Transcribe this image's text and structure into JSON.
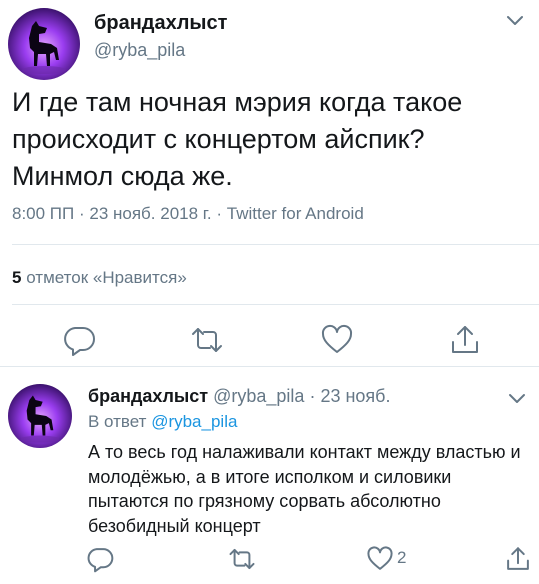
{
  "tweet": {
    "display_name": "брандахлыст",
    "handle": "@ryba_pila",
    "text": "И где там ночная мэрия когда такое происходит с концертом айспик? Минмол сюда же.",
    "time": "8:00 ПП",
    "date": "23 нояб. 2018 г.",
    "source": "Twitter for Android",
    "likes_count": "5",
    "likes_label": "отметок «Нравится»"
  },
  "reply": {
    "display_name": "брандахлыст",
    "handle": "@ryba_pila",
    "date": "23 нояб.",
    "in_reply_label": "В ответ",
    "in_reply_handle": "@ryba_pila",
    "text": "А то весь год налаживали контакт между властью и молодёжью, а в итоге исполком и силовики пытаются по грязному сорвать абсолютно безобидный концерт",
    "like_count": "2"
  },
  "colors": {
    "text": "#14171a",
    "secondary": "#657786",
    "link": "#1b95e0",
    "icon": "#657786",
    "avatar_glow": "#b060ff"
  },
  "icons": [
    "chevron-down-icon",
    "reply-icon",
    "retweet-icon",
    "like-icon",
    "share-icon"
  ]
}
